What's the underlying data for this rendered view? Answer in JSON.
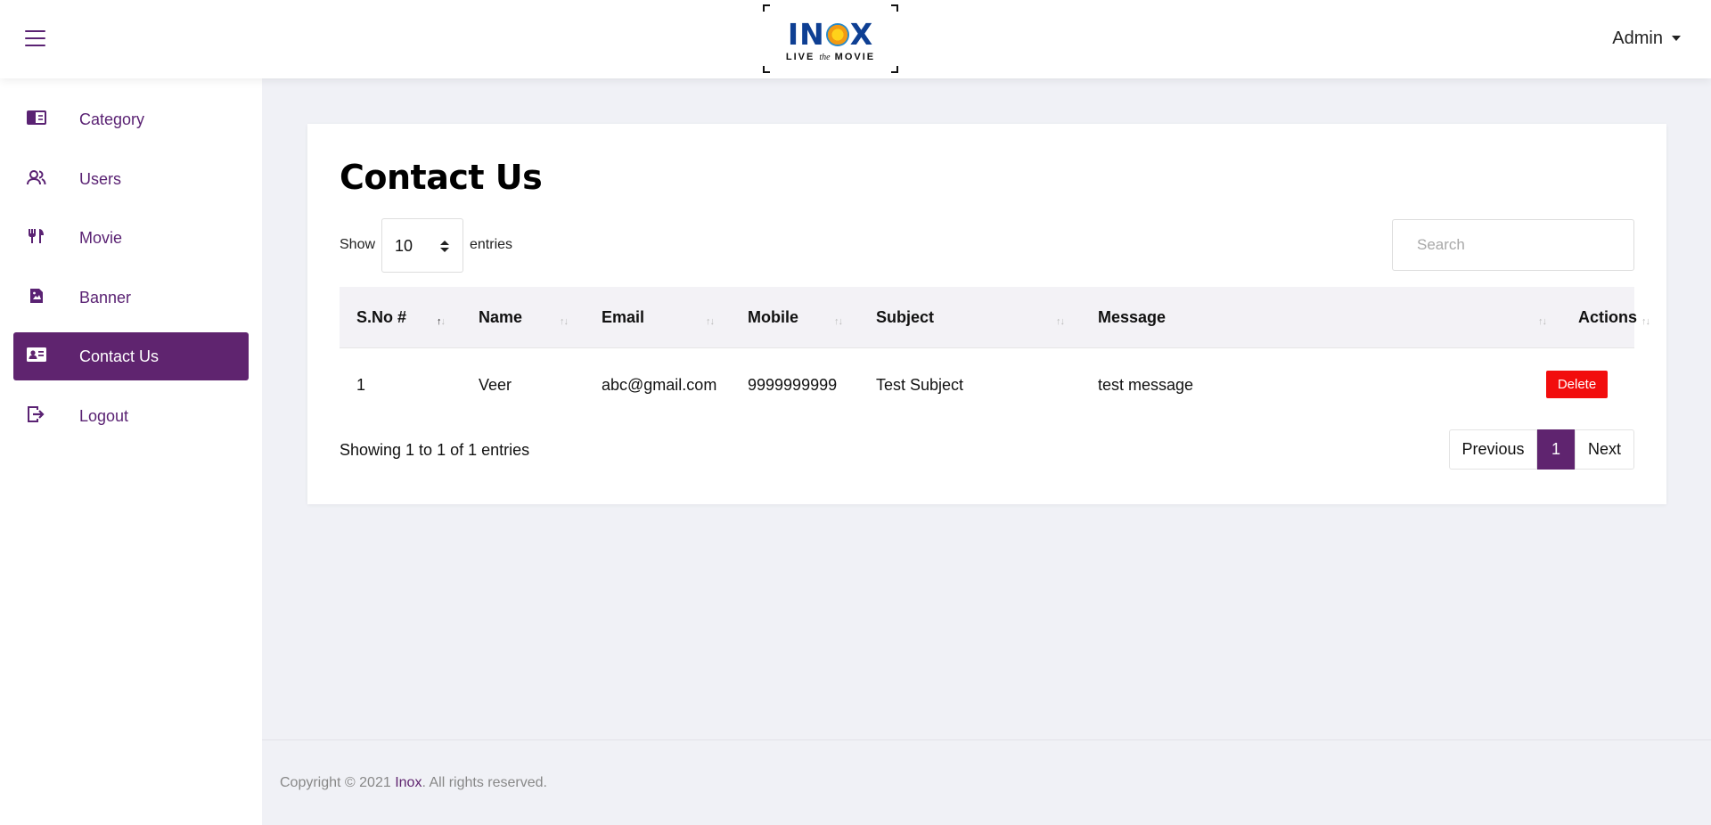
{
  "header": {
    "logo_text": "INOX",
    "logo_tagline": "LIVE the MOVIE",
    "user_menu": "Admin"
  },
  "sidebar": {
    "items": [
      {
        "label": "Category",
        "icon": "category-icon"
      },
      {
        "label": "Users",
        "icon": "users-icon"
      },
      {
        "label": "Movie",
        "icon": "movie-icon"
      },
      {
        "label": "Banner",
        "icon": "banner-icon"
      },
      {
        "label": "Contact Us",
        "icon": "contact-card-icon",
        "active": true
      },
      {
        "label": "Logout",
        "icon": "logout-icon"
      }
    ]
  },
  "main": {
    "title": "Contact Us",
    "length": {
      "show_label": "Show",
      "value": "10",
      "entries_label": "entries"
    },
    "search": {
      "placeholder": "Search",
      "value": ""
    },
    "table": {
      "columns": [
        "S.No #",
        "Name",
        "Email",
        "Mobile",
        "Subject",
        "Message",
        "Actions"
      ],
      "sorted_column": "S.No #",
      "rows": [
        {
          "sno": "1",
          "name": "Veer",
          "email": "abc@gmail.com",
          "mobile": "9999999999",
          "subject": "Test Subject",
          "message": "test message",
          "action": "Delete"
        }
      ]
    },
    "info": "Showing 1 to 1 of 1 entries",
    "pagination": {
      "previous": "Previous",
      "current": "1",
      "next": "Next"
    }
  },
  "footer": {
    "prefix": "Copyright © 2021 ",
    "brand": "Inox",
    "suffix": ". All rights reserved."
  },
  "colors": {
    "primary": "#5f246f",
    "delete": "#f20d0d",
    "background": "#f0f1f6"
  }
}
